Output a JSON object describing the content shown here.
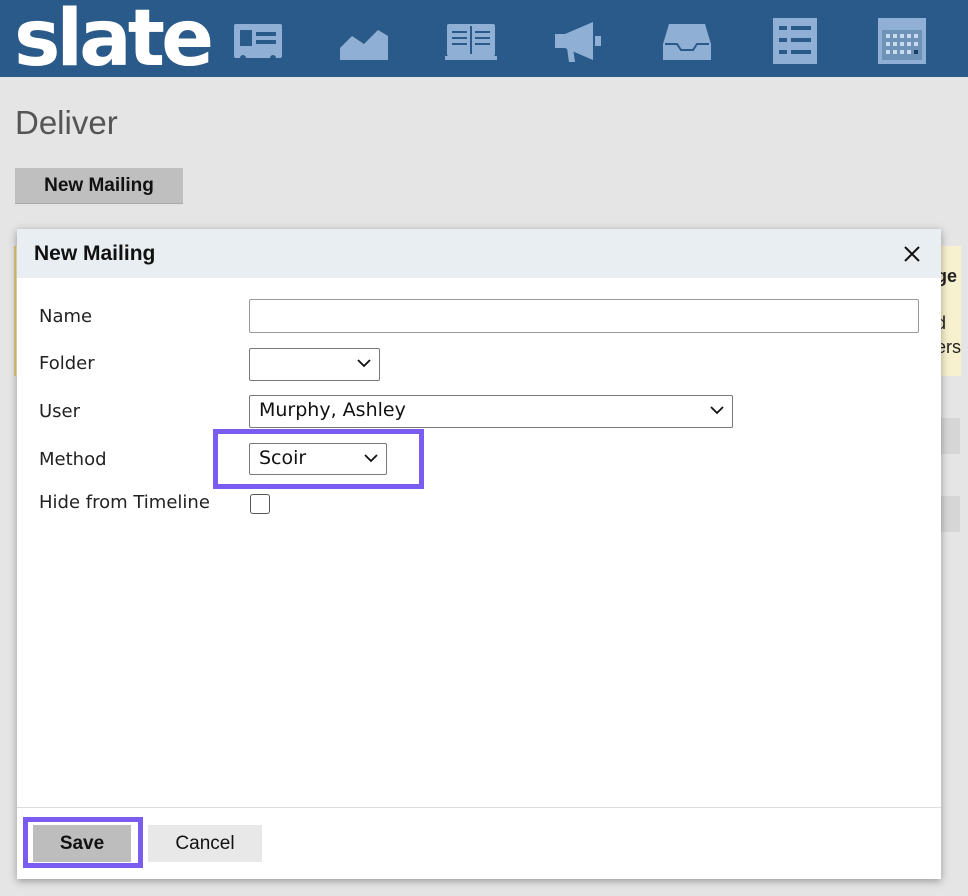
{
  "header": {
    "logo_text": "slate",
    "nav_icons": [
      "contact-card-icon",
      "chart-area-icon",
      "book-icon",
      "megaphone-icon",
      "inbox-tray-icon",
      "list-icon",
      "calendar-icon"
    ]
  },
  "page": {
    "title": "Deliver",
    "new_mailing_button": "New Mailing"
  },
  "background": {
    "fragment_1": "ge",
    "fragment_2": "d",
    "fragment_3": "ers"
  },
  "dialog": {
    "title": "New Mailing",
    "close_icon": "close-icon",
    "fields": {
      "name_label": "Name",
      "name_value": "",
      "folder_label": "Folder",
      "folder_value": "",
      "user_label": "User",
      "user_value": "Murphy, Ashley",
      "method_label": "Method",
      "method_value": "Scoir",
      "hide_label": "Hide from Timeline",
      "hide_checked": false
    },
    "save_label": "Save",
    "cancel_label": "Cancel"
  },
  "colors": {
    "topbar": "#2a5a8a",
    "nav_icon": "#8fb0d4",
    "highlight": "#7b5cf0"
  }
}
